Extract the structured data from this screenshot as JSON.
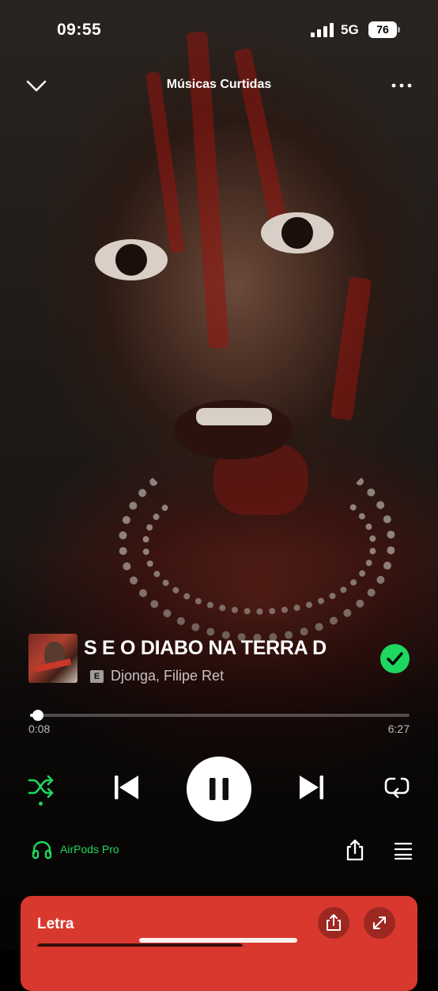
{
  "status_bar": {
    "time": "09:55",
    "network": "5G",
    "battery": "76"
  },
  "header": {
    "title": "Músicas Curtidas"
  },
  "background": {
    "description_icon": "album-art-background"
  },
  "track": {
    "title": "S E O DIABO NA TERRA D",
    "explicit_badge": "E",
    "artists": "Djonga, Filipe Ret",
    "liked": true
  },
  "playback": {
    "elapsed": "0:08",
    "total": "6:27",
    "progress_fraction": 0.021,
    "state": "playing",
    "shuffle_enabled": true
  },
  "device": {
    "name": "AirPods Pro"
  },
  "lyrics": {
    "label": "Letra"
  },
  "colors": {
    "accent_green": "#1ed760",
    "lyrics_card": "#d9382e"
  },
  "icons": {
    "collapse": "chevron-down-icon",
    "more": "more-horizontal-icon",
    "liked": "check-circle-icon",
    "shuffle": "shuffle-icon",
    "previous": "skip-previous-icon",
    "pause": "pause-icon",
    "next": "skip-next-icon",
    "repeat": "repeat-icon",
    "device": "headphones-icon",
    "share": "share-icon",
    "queue": "queue-icon",
    "expand": "expand-icon"
  }
}
